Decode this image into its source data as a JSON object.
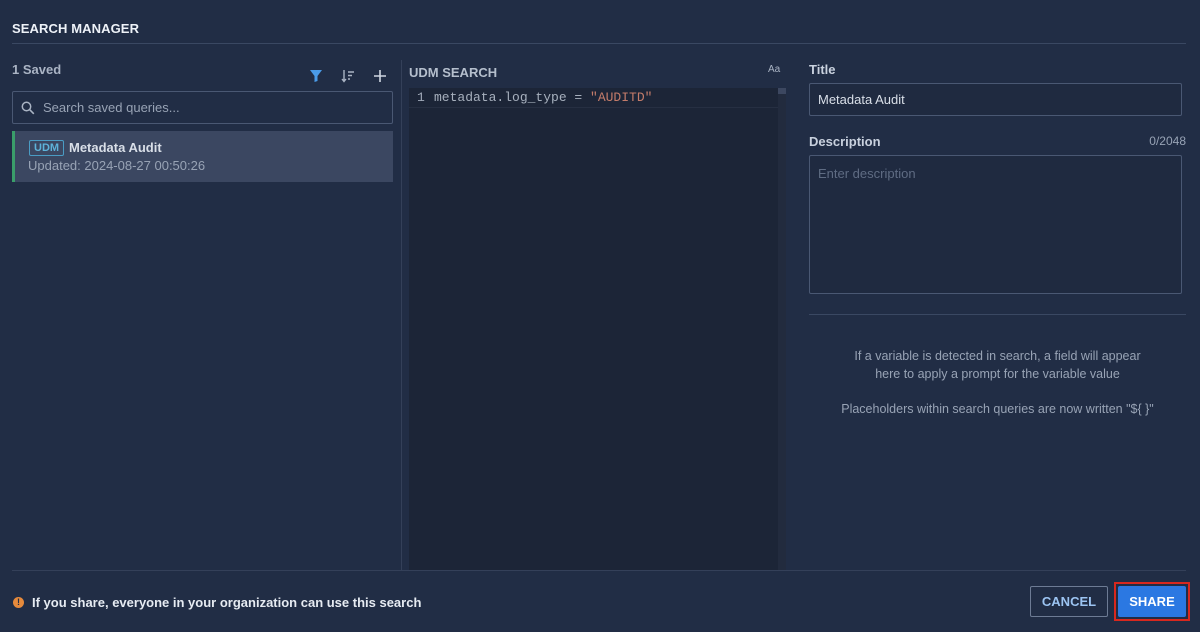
{
  "header": {
    "title": "SEARCH MANAGER"
  },
  "left": {
    "saved_count": "1 Saved",
    "search": {
      "placeholder": "Search saved queries..."
    },
    "items": [
      {
        "badge": "UDM",
        "name": "Metadata Audit",
        "updated": "Updated: 2024-08-27 00:50:26"
      }
    ]
  },
  "editor": {
    "title": "UDM SEARCH",
    "case_toggle": "Aa",
    "lines": [
      {
        "number": "1",
        "code": "metadata.log_type = ",
        "string": "\"AUDITD\""
      }
    ]
  },
  "details": {
    "title_label": "Title",
    "title_value": "Metadata Audit",
    "description_label": "Description",
    "description_counter": "0/2048",
    "description_placeholder": "Enter description",
    "info_line1": "If a variable is detected in search, a field will appear",
    "info_line2": "here to apply a prompt for the variable value",
    "info_line3": "Placeholders within search queries are now written \"${ }\""
  },
  "footer": {
    "warning": "If you share, everyone in your organization can use this search",
    "cancel_label": "CANCEL",
    "share_label": "SHARE"
  },
  "colors": {
    "background": "#212d45",
    "accent": "#2b78e2",
    "selected_bar": "#3a9e6a",
    "warning": "#e68a3c",
    "highlight": "#d8281e"
  }
}
